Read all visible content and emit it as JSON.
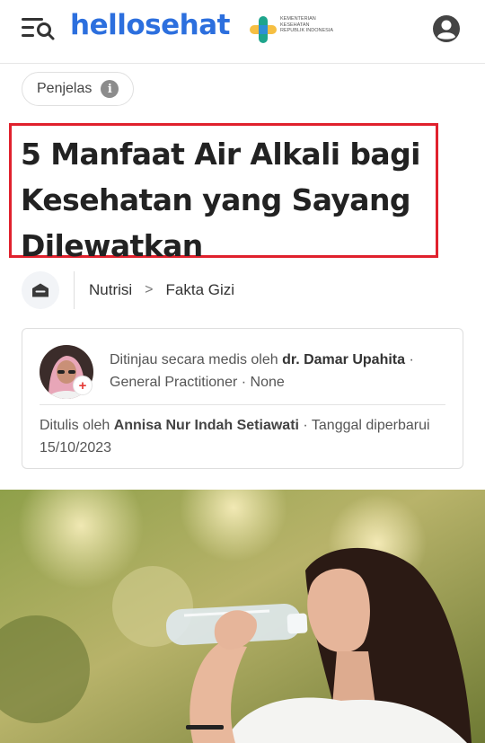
{
  "header": {
    "logo_text": "hellosehat",
    "kemenkes_text": "KEMENTERIAN KESEHATAN REPUBLIK INDONESIA"
  },
  "chip": {
    "label": "Penjelas",
    "info_glyph": "i"
  },
  "article": {
    "title": "5 Manfaat Air Alkali bagi Kesehatan yang Sayang Dilewatkan"
  },
  "breadcrumb": {
    "items": [
      "Nutrisi",
      "Fakta Gizi"
    ],
    "separator": ">"
  },
  "review": {
    "prefix": "Ditinjau secara medis oleh ",
    "reviewer": "dr. Damar Upahita",
    "suffix": " · General Practitioner · None",
    "badge_glyph": "+"
  },
  "author": {
    "prefix": "Ditulis oleh ",
    "name": "Annisa Nur Indah Setiawati",
    "suffix": " · Tanggal diperbarui 15/10/2023"
  },
  "colors": {
    "brand_blue": "#2c6fde",
    "highlight_red": "#e0212d",
    "kemenkes_teal": "#1ea58c"
  },
  "icons": [
    "menu-search-icon",
    "kemenkes-logo-icon",
    "user-avatar-icon",
    "info-icon",
    "home-icon",
    "chevron-right-icon",
    "medical-cross-icon"
  ]
}
